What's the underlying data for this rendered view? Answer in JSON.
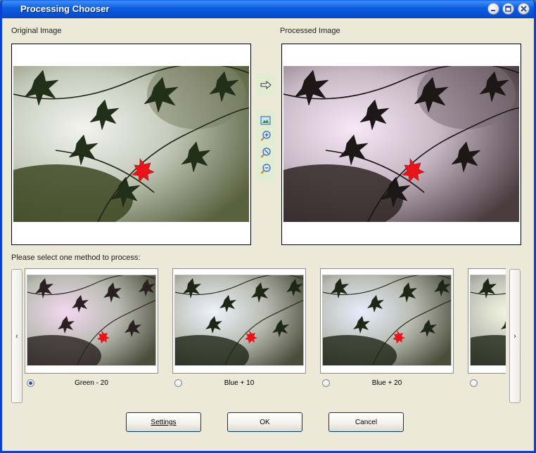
{
  "window": {
    "title": "Processing Chooser"
  },
  "titlebar_buttons": [
    "minimize-icon",
    "maximize-icon",
    "close-icon"
  ],
  "labels": {
    "original": "Original Image",
    "processed": "Processed Image",
    "select_method": "Please select one method to process:"
  },
  "tools": [
    "arrow-right-icon",
    "fit-image-icon",
    "zoom-in-icon",
    "zoom-actual-icon",
    "zoom-out-icon"
  ],
  "methods": [
    {
      "label": "Green - 20",
      "selected": true,
      "tint": "#f3d8f0"
    },
    {
      "label": "Blue + 10",
      "selected": false,
      "tint": "#eef3fb"
    },
    {
      "label": "Blue + 20",
      "selected": false,
      "tint": "#e6eefc"
    },
    {
      "label": "",
      "selected": false,
      "tint": "#f6f8e4"
    }
  ],
  "nav": {
    "prev": "‹",
    "next": "›"
  },
  "buttons": {
    "settings": "Settings",
    "ok": "OK",
    "cancel": "Cancel"
  },
  "colors": {
    "titlebar": "#0a5fe8",
    "leaf_red": "#e8141a",
    "dialog_bg": "#ece9d8"
  }
}
